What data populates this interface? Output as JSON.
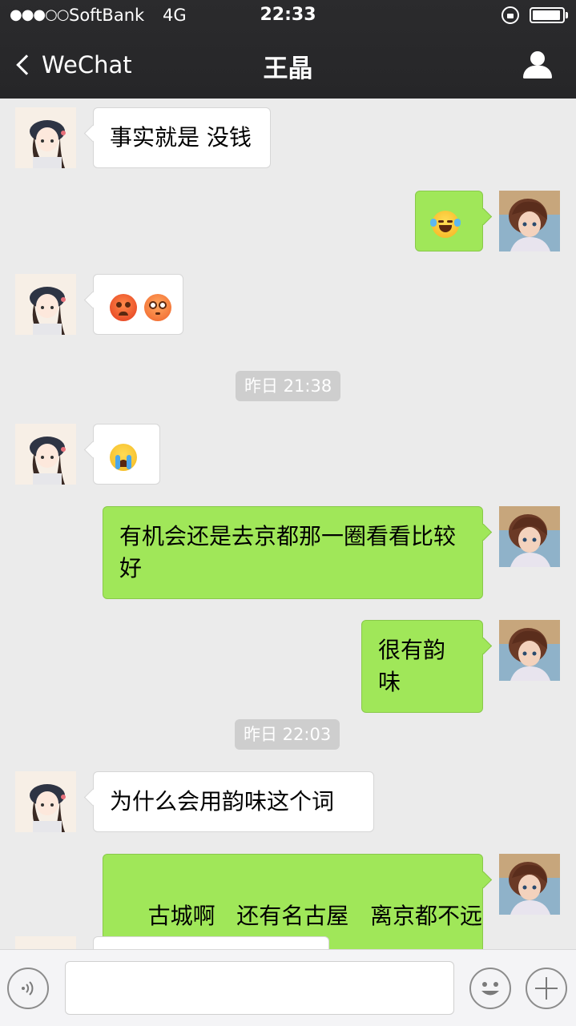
{
  "status_bar": {
    "signal": "●●●○○",
    "carrier": "SoftBank",
    "network": "4G",
    "time": "22:33",
    "battery_level": 0.9
  },
  "nav": {
    "back_label": "WeChat",
    "title": "王晶"
  },
  "messages": [
    {
      "sender": "contact",
      "text": "事实就是 没钱"
    },
    {
      "sender": "me",
      "emoji": [
        "laughing-crying-face-icon"
      ]
    },
    {
      "sender": "contact",
      "emoji": [
        "angry-face-icon",
        "flushed-face-icon"
      ]
    },
    {
      "timestamp": "昨日 21:38"
    },
    {
      "sender": "contact",
      "emoji": [
        "loudly-crying-face-icon"
      ]
    },
    {
      "sender": "me",
      "text": "有机会还是去京都那一圈看看比较好"
    },
    {
      "sender": "me",
      "text": "很有韵味"
    },
    {
      "timestamp": "昨日 22:03"
    },
    {
      "sender": "contact",
      "text": "为什么会用韵味这个词"
    },
    {
      "sender": "me",
      "text": "古城啊   还有名古屋   离京都不远"
    }
  ],
  "colors": {
    "nav_bg": "#262628",
    "chat_bg": "#ebebeb",
    "outgoing_bubble": "#a0e759",
    "incoming_bubble": "#ffffff",
    "timestamp_bg": "#cecece"
  },
  "input_bar": {
    "icons": [
      "voice-icon",
      "emoji-face-icon",
      "plus-icon"
    ]
  }
}
